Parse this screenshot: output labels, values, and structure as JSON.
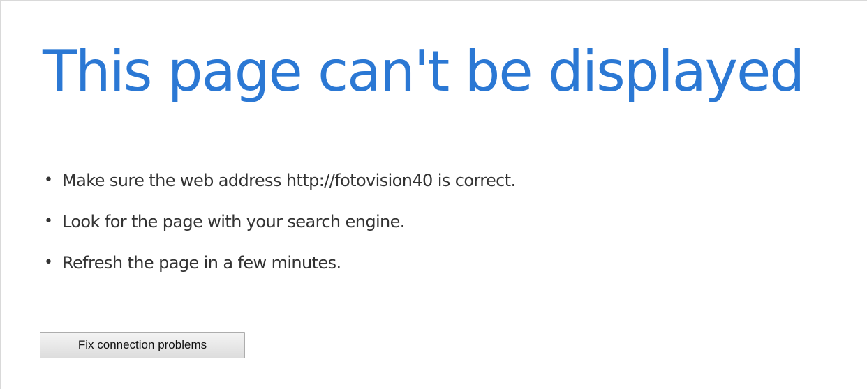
{
  "page": {
    "title": "This page can't be displayed",
    "tips": [
      "Make sure the web address http://fotovision40 is correct.",
      "Look for the page with your search engine.",
      "Refresh the page in a few minutes."
    ],
    "bullet_glyph": "•",
    "fix_button_label": "Fix connection problems"
  },
  "colors": {
    "title": "#2b78d4",
    "body_text": "#333333",
    "background": "#ffffff"
  }
}
